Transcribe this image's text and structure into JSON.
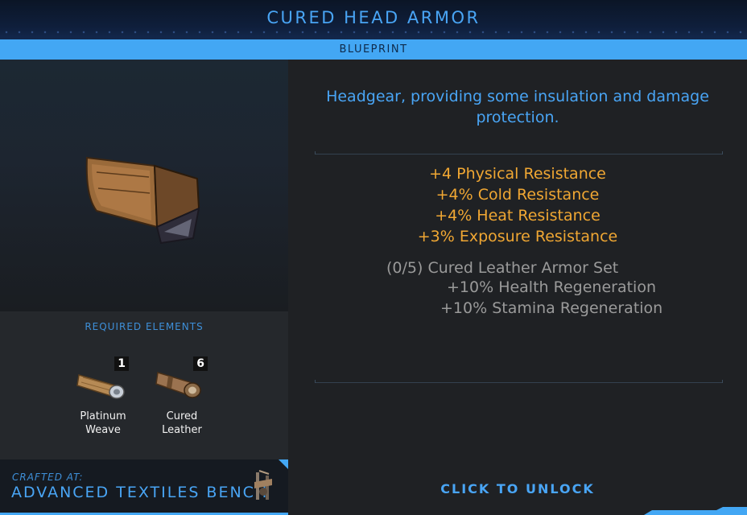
{
  "header": {
    "title": "CURED HEAD ARMOR",
    "subtitle": "BLUEPRINT"
  },
  "item": {
    "icon": "cured-head-armor-image",
    "description": "Headgear, providing some insulation and damage protection."
  },
  "requirements": {
    "title": "REQUIRED ELEMENTS",
    "items": [
      {
        "name_line1": "Platinum",
        "name_line2": "Weave",
        "count": "1",
        "icon": "platinum-weave-icon"
      },
      {
        "name_line1": "Cured",
        "name_line2": "Leather",
        "count": "6",
        "icon": "cured-leather-icon"
      }
    ]
  },
  "crafted_at": {
    "label": "CRAFTED AT:",
    "bench": "ADVANCED TEXTILES BENCH",
    "icon": "textiles-bench-icon"
  },
  "stats": [
    "+4 Physical Resistance",
    "+4% Cold Resistance",
    "+4% Heat Resistance",
    "+3% Exposure Resistance"
  ],
  "set_bonus": {
    "title": "(0/5) Cured Leather Armor Set",
    "bonuses": [
      "+10% Health Regeneration",
      "+10% Stamina Regeneration"
    ]
  },
  "actions": {
    "unlock_label": "CLICK TO UNLOCK"
  },
  "colors": {
    "accent_blue": "#49a5f5",
    "stat_orange": "#f0a733",
    "set_gray": "#9a9a9a"
  }
}
